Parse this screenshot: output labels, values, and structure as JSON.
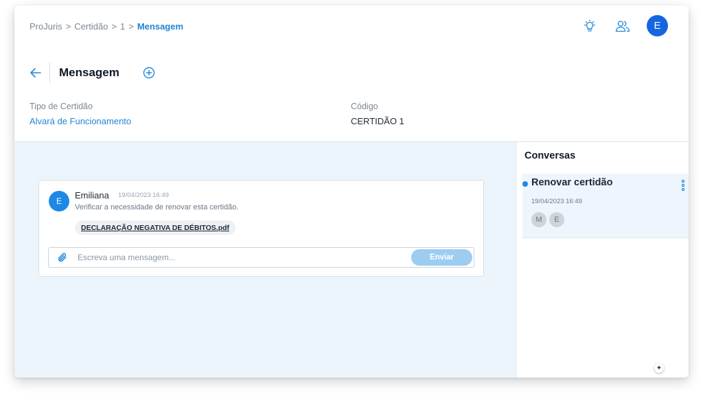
{
  "breadcrumb": {
    "items": [
      "ProJuris",
      "Certidão",
      "1"
    ],
    "current": "Mensagem",
    "separator": ">"
  },
  "header": {
    "icons": [
      "lightbulb-icon",
      "users-icon"
    ],
    "user_initial": "E"
  },
  "page": {
    "title": "Mensagem"
  },
  "fields": {
    "tipo_label": "Tipo de Certidão",
    "tipo_value": "Alvará de Funcionamento",
    "codigo_label": "Código",
    "codigo_value": "CERTIDÃO 1"
  },
  "message": {
    "author_initial": "E",
    "author": "Emiliana",
    "time": "19/04/2023 16:49",
    "text": "Verificar a necessidade de renovar esta certidão.",
    "attachment": "DECLARAÇÃO NEGATIVA DE DÉBITOS.pdf"
  },
  "composer": {
    "placeholder": "Escreva uma mensagem...",
    "send_label": "Enviar"
  },
  "conversations": {
    "title": "Conversas",
    "items": [
      {
        "name": "Renovar certidão",
        "time": "19/04/2023 16:49",
        "participants": [
          "M",
          "E"
        ]
      }
    ]
  },
  "colors": {
    "accent": "#1f86d8",
    "avatar": "#1565e0",
    "chat_bg": "#edf5fc",
    "send_disabled": "#9dccf1"
  }
}
